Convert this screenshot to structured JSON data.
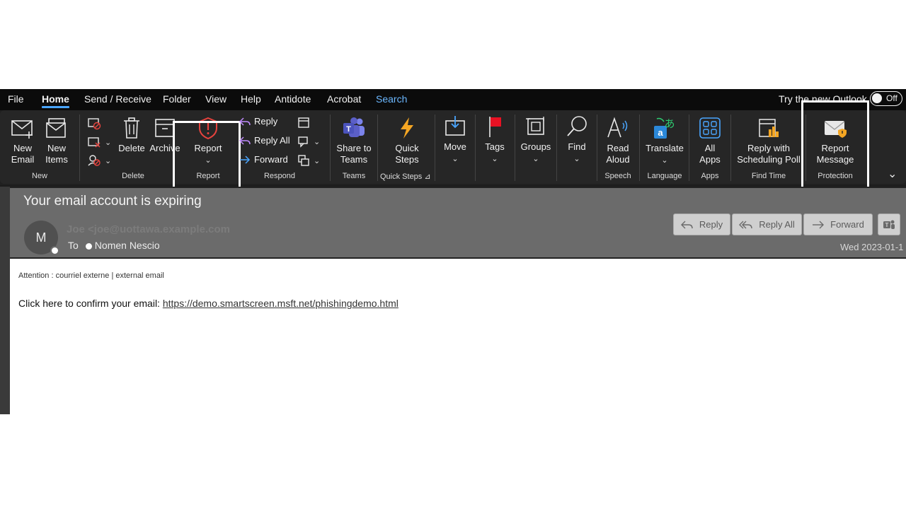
{
  "menubar": {
    "tabs": [
      "File",
      "Home",
      "Send / Receive",
      "Folder",
      "View",
      "Help",
      "Antidote",
      "Acrobat",
      "Search"
    ],
    "try_new_outlook": "Try the new Outlook",
    "toggle_label": "Off"
  },
  "ribbon": {
    "new_email": "New\nEmail",
    "new_items": "New\nItems",
    "delete": "Delete",
    "archive": "Archive",
    "report": "Report",
    "reply": "Reply",
    "reply_all": "Reply All",
    "forward": "Forward",
    "share_to_teams": "Share to\nTeams",
    "quick_steps": "Quick\nSteps",
    "move": "Move",
    "tags": "Tags",
    "groups": "Groups",
    "find": "Find",
    "read_aloud": "Read\nAloud",
    "translate": "Translate",
    "all_apps": "All\nApps",
    "reply_with_poll": "Reply with\nScheduling Poll",
    "report_message": "Report\nMessage",
    "groups_labels": {
      "new": "New",
      "delete": "Delete",
      "report": "Report",
      "respond": "Respond",
      "teams": "Teams",
      "quick_steps": "Quick Steps",
      "speech": "Speech",
      "language": "Language",
      "apps": "Apps",
      "find_time": "Find Time",
      "protection": "Protection"
    }
  },
  "message": {
    "subject": "Your email account is expiring",
    "avatar_initial": "M",
    "from": "Joe <joe@uottawa.example.com",
    "to_label": "To",
    "to_name": "Nomen Nescio",
    "date": "Wed 2023-01-1",
    "actions": {
      "reply": "Reply",
      "reply_all": "Reply All",
      "forward": "Forward"
    },
    "external_notice": "Attention : courriel externe | external email",
    "body_text": "Click here to confirm your email: ",
    "link": "https://demo.smartscreen.msft.net/phishingdemo.html"
  },
  "colors": {
    "accent": "#4aa6ff",
    "report_icon": "#e8433e",
    "teams_icon": "#5b5fc7",
    "quick_steps_icon": "#f5a623",
    "tags_flag": "#e81123",
    "highlight_box": "#ffffff"
  }
}
